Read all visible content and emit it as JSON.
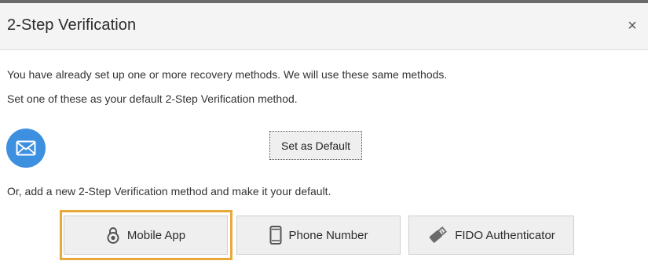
{
  "dialog": {
    "title": "2-Step Verification",
    "close_label": "×"
  },
  "body": {
    "info_line": "You have already set up one or more recovery methods. We will use these same methods.",
    "instruction_line": "Set one of these as your default 2-Step Verification method.",
    "existing_method_icon": "email-icon",
    "set_default_label": "Set as Default",
    "add_new_line": "Or, add a new 2-Step Verification method and make it your default."
  },
  "methods": [
    {
      "label": "Mobile App",
      "icon": "padlock-icon",
      "highlighted": true
    },
    {
      "label": "Phone Number",
      "icon": "phone-icon",
      "highlighted": false
    },
    {
      "label": "FIDO Authenticator",
      "icon": "usb-key-icon",
      "highlighted": false
    }
  ],
  "colors": {
    "accent_blue": "#3d8fe0",
    "highlight_orange": "#e9a93a",
    "header_bg": "#f4f4f4"
  }
}
